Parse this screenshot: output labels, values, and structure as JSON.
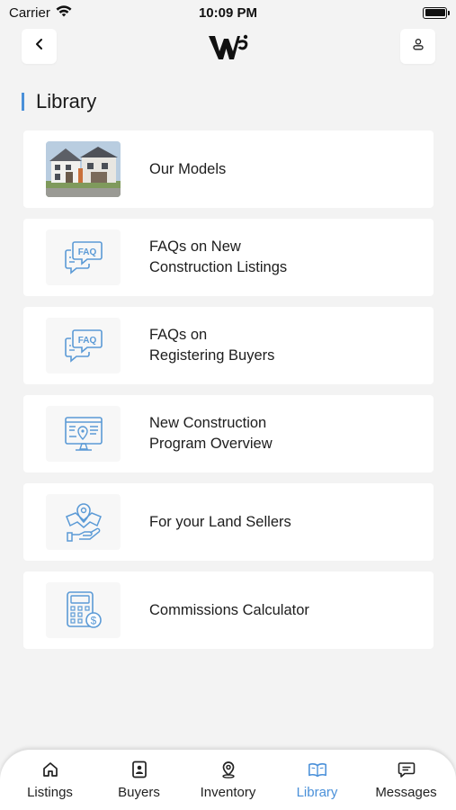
{
  "status_bar": {
    "carrier": "Carrier",
    "time": "10:09 PM"
  },
  "header": {
    "logo_icon": "w-logo",
    "back_icon": "chevron-left-icon",
    "profile_icon": "user-icon"
  },
  "page": {
    "title": "Library"
  },
  "library_items": [
    {
      "label": "Our Models",
      "icon": "house-photo"
    },
    {
      "label": "FAQs on New\nConstruction Listings",
      "icon": "faq-chat-icon"
    },
    {
      "label": "FAQs on\nRegistering Buyers",
      "icon": "faq-chat-icon"
    },
    {
      "label": "New Construction\nProgram Overview",
      "icon": "monitor-map-icon"
    },
    {
      "label": "For your Land Sellers",
      "icon": "land-location-hand-icon"
    },
    {
      "label": "Commissions Calculator",
      "icon": "calculator-dollar-icon"
    }
  ],
  "tabs": [
    {
      "label": "Listings",
      "icon": "home-icon",
      "active": false
    },
    {
      "label": "Buyers",
      "icon": "contact-card-icon",
      "active": false
    },
    {
      "label": "Inventory",
      "icon": "location-pin-icon",
      "active": false
    },
    {
      "label": "Library",
      "icon": "open-book-icon",
      "active": true
    },
    {
      "label": "Messages",
      "icon": "chat-bubble-icon",
      "active": false
    }
  ],
  "colors": {
    "accent": "#4a90d9",
    "icon_blue": "#5b9ad6",
    "background": "#f3f3f3",
    "card": "#ffffff"
  }
}
